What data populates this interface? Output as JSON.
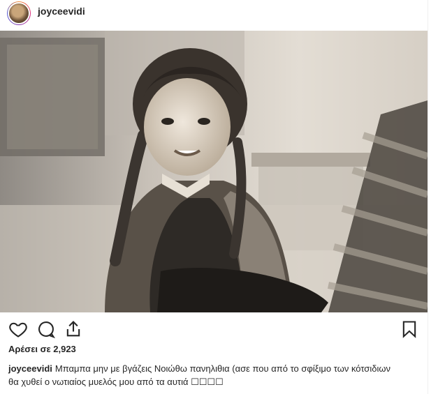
{
  "header": {
    "username": "joyceevidi",
    "avatar_icon": "profile-photo-avatar"
  },
  "photo": {
    "description_icon": "black-and-white-photo-girl-with-braids-on-chair",
    "tone": "#bdb3a6"
  },
  "actions": {
    "like_icon": "heart-icon",
    "comment_icon": "comment-icon",
    "share_icon": "share-icon",
    "save_icon": "bookmark-icon"
  },
  "likes": {
    "text": "Αρέσει σε 2,923"
  },
  "caption": {
    "username": "joyceevidi",
    "text": "Μπαμπα μην με βγάζεις Νοιώθω πανηλιθια (ασε που από το σφίξιμο των κότσιδιων θα χυθεί ο νωτιαίος μυελός μου από τα αυτιά ☐☐☐☐"
  }
}
